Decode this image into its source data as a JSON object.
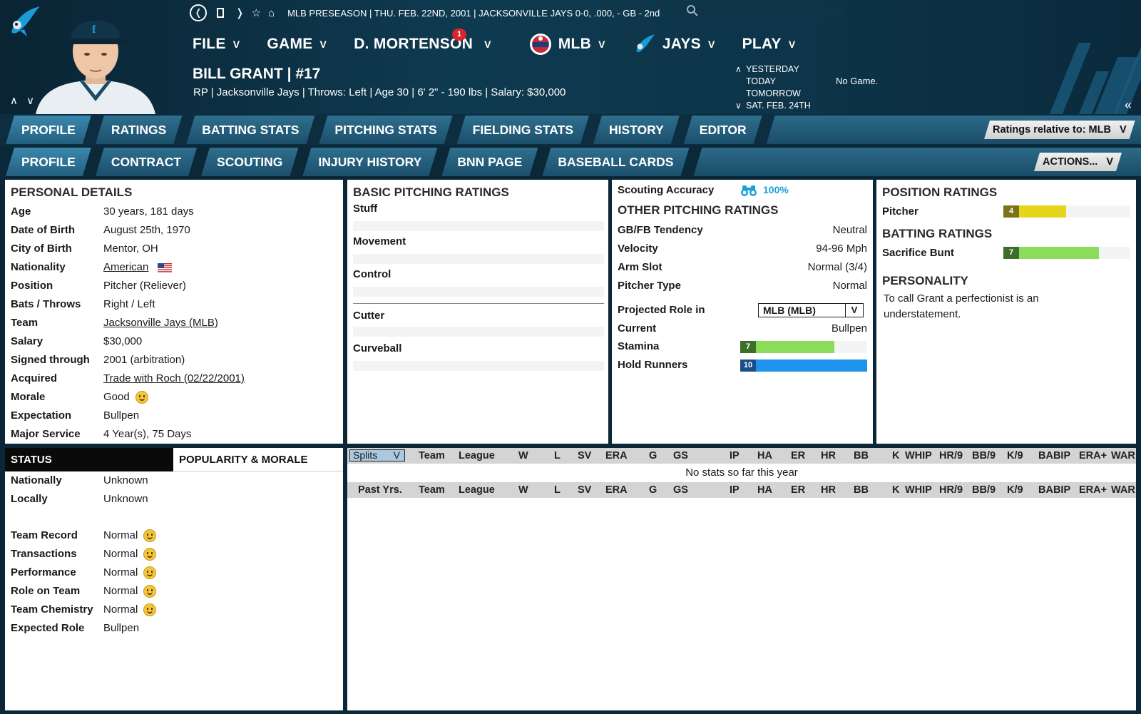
{
  "header": {
    "info": "MLB PRESEASON  |  THU. FEB. 22ND, 2001  |  JACKSONVILLE JAYS  0-0, .000, - GB - 2nd",
    "menu": [
      {
        "label": "FILE"
      },
      {
        "label": "GAME"
      },
      {
        "label": "D. MORTENSON",
        "badge": "1"
      },
      {
        "label": "MLB"
      },
      {
        "label": "JAYS"
      },
      {
        "label": "PLAY"
      }
    ],
    "player_name": "BILL GRANT  |  #17",
    "player_sub": "RP  |  Jacksonville Jays  |  Throws: Left  |  Age 30  |  6' 2\" - 190 lbs  |  Salary: $30,000",
    "dates": [
      "YESTERDAY",
      "TODAY",
      "TOMORROW",
      "SAT. FEB. 24TH"
    ],
    "no_game": "No Game."
  },
  "tabs1": [
    "PROFILE",
    "RATINGS",
    "BATTING STATS",
    "PITCHING STATS",
    "FIELDING STATS",
    "HISTORY",
    "EDITOR"
  ],
  "ratings_relative": "Ratings relative to: MLB",
  "tabs2": [
    "PROFILE",
    "CONTRACT",
    "SCOUTING",
    "INJURY HISTORY",
    "BNN PAGE",
    "BASEBALL CARDS"
  ],
  "actions": "ACTIONS...",
  "personal": {
    "title": "PERSONAL DETAILS",
    "rows": [
      {
        "label": "Age",
        "value": "30 years, 181 days"
      },
      {
        "label": "Date of Birth",
        "value": "August 25th, 1970"
      },
      {
        "label": "City of Birth",
        "value": "Mentor, OH"
      },
      {
        "label": "Nationality",
        "value": "American"
      },
      {
        "label": "Position",
        "value": "Pitcher (Reliever)"
      },
      {
        "label": "Bats / Throws",
        "value": "Right / Left"
      },
      {
        "label": "Team",
        "value": "Jacksonville Jays (MLB)"
      },
      {
        "label": "Salary",
        "value": "$30,000"
      },
      {
        "label": "Signed through",
        "value": "2001 (arbitration)"
      },
      {
        "label": "Acquired",
        "value": "Trade with Roch (02/22/2001)"
      },
      {
        "label": "Morale",
        "value": "Good"
      },
      {
        "label": "Expectation",
        "value": "Bullpen"
      },
      {
        "label": "Major Service",
        "value": "4 Year(s), 75 Days"
      }
    ]
  },
  "basic_pitching": {
    "title": "BASIC PITCHING RATINGS",
    "labels": [
      "Stuff",
      "Movement",
      "Control",
      "Cutter",
      "Curveball"
    ]
  },
  "other_pitching": {
    "scouting_label": "Scouting Accuracy",
    "scouting_value": "100%",
    "title": "OTHER PITCHING RATINGS",
    "rows": [
      {
        "label": "GB/FB Tendency",
        "value": "Neutral"
      },
      {
        "label": "Velocity",
        "value": "94-96 Mph"
      },
      {
        "label": "Arm Slot",
        "value": "Normal (3/4)"
      },
      {
        "label": "Pitcher Type",
        "value": "Normal"
      }
    ],
    "projected_label": "Projected Role in",
    "projected_select": "MLB (MLB)",
    "current_label": "Current",
    "current_value": "Bullpen",
    "stamina_label": "Stamina",
    "stamina_value": "7",
    "hold_label": "Hold Runners",
    "hold_value": "10"
  },
  "position": {
    "title": "POSITION RATINGS",
    "pitcher_label": "Pitcher",
    "pitcher_value": "4",
    "batting_title": "BATTING RATINGS",
    "bunt_label": "Sacrifice Bunt",
    "bunt_value": "7",
    "personality_title": "PERSONALITY",
    "personality_text": "To call Grant a perfectionist is an understatement."
  },
  "status": {
    "tab_status": "STATUS",
    "tab_popularity": "POPULARITY & MORALE",
    "rows": [
      {
        "label": "Nationally",
        "value": "Unknown"
      },
      {
        "label": "Locally",
        "value": "Unknown"
      },
      {
        "label": "Team Record",
        "value": "Normal"
      },
      {
        "label": "Transactions",
        "value": "Normal"
      },
      {
        "label": "Performance",
        "value": "Normal"
      },
      {
        "label": "Role on Team",
        "value": "Normal"
      },
      {
        "label": "Team Chemistry",
        "value": "Normal"
      },
      {
        "label": "Expected Role",
        "value": "Bullpen"
      }
    ]
  },
  "stats": {
    "splits": "Splits",
    "past": "Past Yrs.",
    "columns": [
      "Team",
      "League",
      "W",
      "L",
      "SV",
      "ERA",
      "G",
      "GS",
      "IP",
      "HA",
      "ER",
      "HR",
      "BB",
      "K",
      "WHIP",
      "HR/9",
      "BB/9",
      "K/9",
      "BABIP",
      "ERA+",
      "WAR"
    ],
    "empty": "No stats so far this year"
  },
  "colors": {
    "header_bg": "#0e3a50",
    "tab_bg": "#2c6a88",
    "bar_green": "#8cdc5c",
    "bar_green_dark": "#3e6e2a",
    "bar_yellow": "#e6d51c",
    "bar_yellow_dark": "#7a7416",
    "bar_blue": "#1e94ec",
    "bar_blue_dark": "#1a4f86",
    "accent_cyan": "#1aa0d8"
  }
}
